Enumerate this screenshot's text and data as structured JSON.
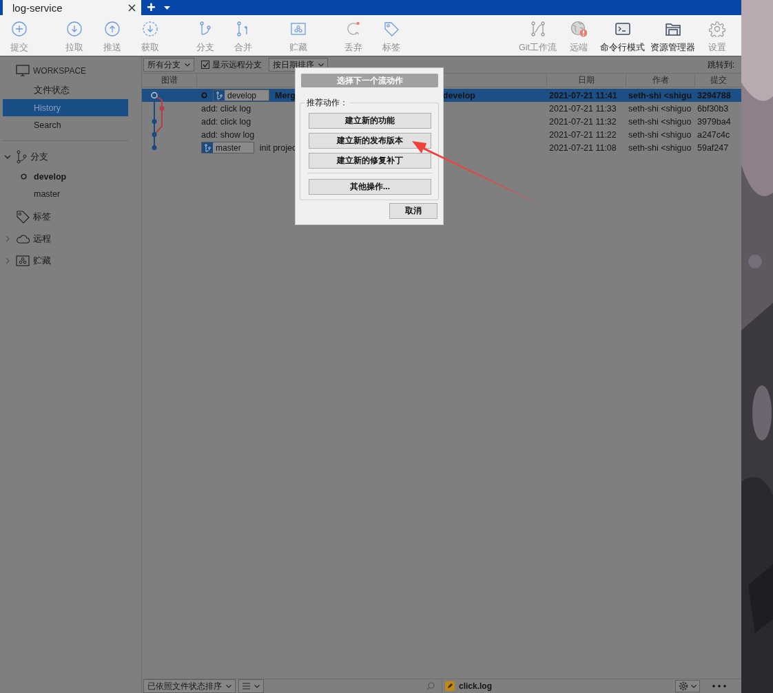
{
  "tab": {
    "title": "log-service",
    "new_tab": "+"
  },
  "toolbar": {
    "groups": [
      {
        "items": [
          {
            "label": "提交",
            "disabled": true
          }
        ]
      },
      {
        "items": [
          {
            "label": "拉取",
            "disabled": true
          },
          {
            "label": "推送",
            "disabled": true
          },
          {
            "label": "获取",
            "disabled": true
          }
        ]
      },
      {
        "items": [
          {
            "label": "分支",
            "disabled": true
          },
          {
            "label": "合并",
            "disabled": true
          }
        ]
      },
      {
        "items": [
          {
            "label": "贮藏",
            "disabled": true
          }
        ]
      },
      {
        "items": [
          {
            "label": "丢弃",
            "disabled": true
          },
          {
            "label": "标签",
            "disabled": true
          }
        ]
      }
    ],
    "right_items": [
      {
        "label": "Git工作流",
        "disabled": true
      },
      {
        "label": "远端",
        "disabled": true
      },
      {
        "label": "命令行模式",
        "disabled": false
      },
      {
        "label": "资源管理器",
        "disabled": false
      },
      {
        "label": "设置",
        "disabled": true
      }
    ]
  },
  "sidebar": {
    "sections": [
      {
        "kind": "workspace",
        "title": "WORKSPACE",
        "items": [
          {
            "label": "文件状态",
            "selected": false
          },
          {
            "label": "History",
            "selected": true
          },
          {
            "label": "Search",
            "selected": false
          }
        ]
      },
      {
        "kind": "branches",
        "title": "分支",
        "expanded": true,
        "items": [
          {
            "label": "develop",
            "current": true
          },
          {
            "label": "master",
            "current": false
          }
        ]
      },
      {
        "kind": "tags",
        "title": "标签"
      },
      {
        "kind": "remotes",
        "title": "远程",
        "expanded": false
      },
      {
        "kind": "stashes",
        "title": "贮藏",
        "expanded": false
      }
    ]
  },
  "filters": {
    "branch_filter": "所有分支",
    "show_remote": {
      "label": "显示远程分支",
      "checked": true
    },
    "sort": "按日期排序",
    "jump_label": "跳转到:"
  },
  "columns": {
    "graph": "图谱",
    "date": "日期",
    "author": "作者",
    "hash": "提交"
  },
  "commits": [
    {
      "refs": [
        {
          "name": "develop",
          "current": true
        }
      ],
      "message": "Merg",
      "message_tail": "develop",
      "date": "2021-07-21 11:41",
      "author": "seth-shi <shigu",
      "hash": "3294788",
      "selected": true,
      "head": true
    },
    {
      "message": "add: click log",
      "date": "2021-07-21 11:33",
      "author": "seth-shi <shiguo",
      "hash": "6bf30b3",
      "selected": false,
      "head": false
    },
    {
      "message": "add: click log",
      "date": "2021-07-21 11:32",
      "author": "seth-shi <shiguo",
      "hash": "3979ba4",
      "selected": false,
      "head": false
    },
    {
      "message": "add: show log",
      "date": "2021-07-21 11:22",
      "author": "seth-shi <shiguo",
      "hash": "a247c4c",
      "selected": false,
      "head": false
    },
    {
      "refs": [
        {
          "name": "master",
          "current": false
        }
      ],
      "message": "init projec",
      "date": "2021-07-21 11:08",
      "author": "seth-shi <shiguo",
      "hash": "59af247",
      "selected": false,
      "head": false
    }
  ],
  "bottom_bar": {
    "sort": "已依照文件状态排序",
    "file": "click.log"
  },
  "dialog": {
    "title": "选择下一个流动作",
    "group_label": "推荐动作：",
    "actions": [
      "建立新的功能",
      "建立新的发布版本",
      "建立新的修复补丁"
    ],
    "other": "其他操作...",
    "cancel": "取消"
  }
}
